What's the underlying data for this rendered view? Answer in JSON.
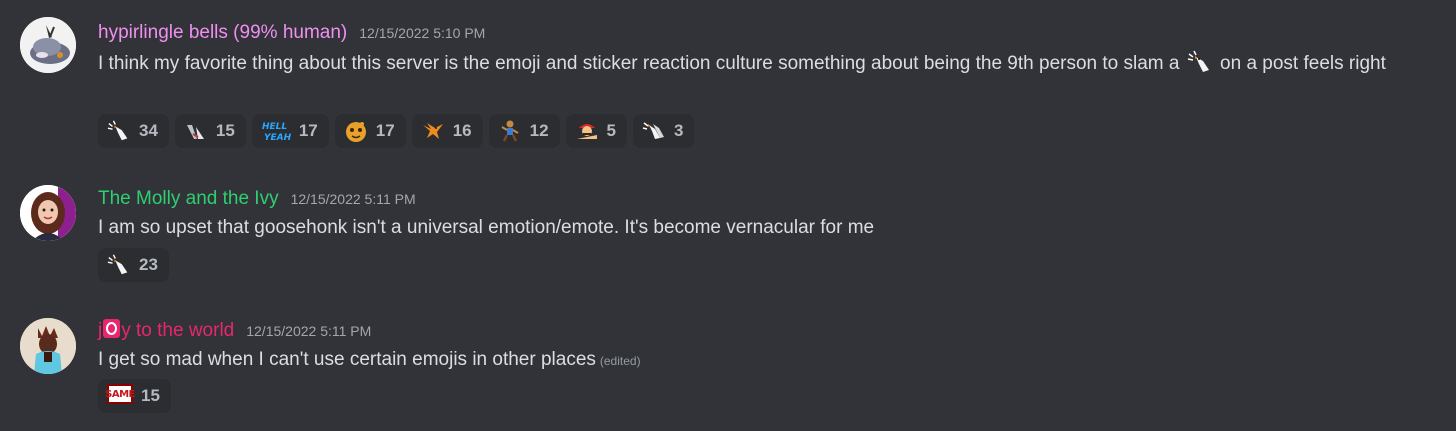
{
  "messages": [
    {
      "username": "hypirlingle bells (99% human)",
      "username_color": "#f08ff0",
      "timestamp": "12/15/2022 5:10 PM",
      "content_before": "I think my favorite thing about this server is the emoji and sticker reaction culture something about being the 9th person to slam a",
      "inline_emoji": "goosehonk-icon",
      "content_after": "on a post feels right",
      "reactions": [
        {
          "emoji": "goosehonk-icon",
          "count": "34"
        },
        {
          "emoji": "shark-icon",
          "count": "15"
        },
        {
          "emoji": "hell-yeah-icon",
          "count": "17"
        },
        {
          "emoji": "cookie-face-icon",
          "count": "17"
        },
        {
          "emoji": "orange-bird-icon",
          "count": "16"
        },
        {
          "emoji": "dancing-figure-icon",
          "count": "12"
        },
        {
          "emoji": "mario-icon",
          "count": "5"
        },
        {
          "emoji": "goose-honks-icon",
          "count": "3"
        }
      ]
    },
    {
      "username": "The Molly and the Ivy",
      "username_color": "#2fcf6f",
      "timestamp": "12/15/2022 5:11 PM",
      "content": "I am so upset that goosehonk isn't a universal emotion/emote. It's become vernacular for me",
      "reactions": [
        {
          "emoji": "goosehonk-icon",
          "count": "23"
        }
      ]
    },
    {
      "username_part1": "j",
      "username_part2": "y to the world",
      "username_color": "#e8266f",
      "timestamp": "12/15/2022 5:11 PM",
      "content": "I get so mad when I can't use certain emojis in other places",
      "edited": "(edited)",
      "reactions": [
        {
          "emoji": "same-icon",
          "label": "SAME",
          "count": "15"
        }
      ]
    }
  ]
}
